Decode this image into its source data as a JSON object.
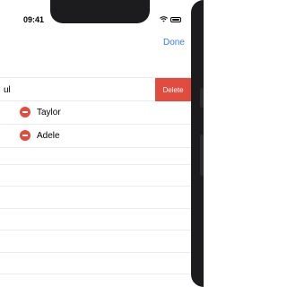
{
  "status_bar": {
    "time": "09:41"
  },
  "nav": {
    "done_label": "Done"
  },
  "rows": [
    {
      "label": "ul",
      "action": "Delete"
    },
    {
      "label": "Taylor"
    },
    {
      "label": "Adele"
    }
  ],
  "colors": {
    "accent": "#3478f6",
    "destructive": "#e24c3f"
  },
  "icons": {
    "wifi": "wifi-icon",
    "battery": "battery-icon",
    "delete_indicator": "minus-circle-icon"
  }
}
